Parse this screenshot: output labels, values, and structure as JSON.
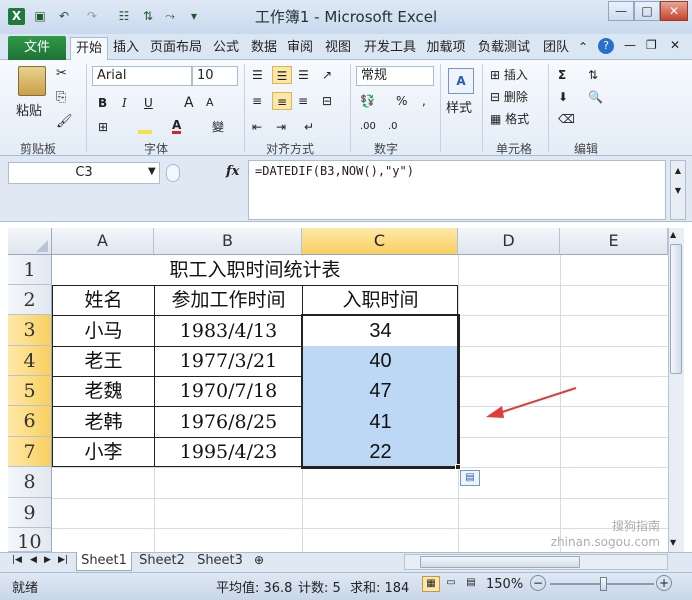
{
  "window": {
    "title": "工作簿1 - Microsoft Excel",
    "app_icon": "excel-icon",
    "controls": [
      "—",
      "□",
      "✕"
    ]
  },
  "tabs": {
    "file": "文件",
    "items": [
      "开始",
      "插入",
      "页面布局",
      "公式",
      "数据",
      "审阅",
      "视图",
      "开发工具",
      "加载项",
      "负载测试",
      "团队"
    ],
    "active": "开始"
  },
  "ribbon": {
    "clipboard": {
      "paste": "粘贴",
      "group": "剪贴板"
    },
    "font": {
      "name": "Arial",
      "size": "10",
      "bold": "B",
      "italic": "I",
      "underline": "U",
      "grow": "A",
      "shrink": "A",
      "group": "字体",
      "wen": "變"
    },
    "alignment": {
      "group": "对齐方式"
    },
    "number": {
      "format": "常规",
      "percent": "%",
      "comma": ",",
      "group": "数字"
    },
    "styles": {
      "label": "样式"
    },
    "cells": {
      "insert": "插入",
      "delete": "删除",
      "format": "格式",
      "group": "单元格"
    },
    "editing": {
      "sigma": "Σ",
      "group": "编辑"
    }
  },
  "formula_bar": {
    "name_box": "C3",
    "fx": "fx",
    "formula": "=DATEDIF(B3,NOW(),\"y\")"
  },
  "grid": {
    "columns": [
      "A",
      "B",
      "C",
      "D",
      "E"
    ],
    "rows": [
      "1",
      "2",
      "3",
      "4",
      "5",
      "6",
      "7",
      "8",
      "9",
      "10"
    ],
    "selected_column": "C",
    "selected_rows": [
      "3",
      "4",
      "5",
      "6",
      "7"
    ],
    "title": "职工入职时间统计表",
    "headers": [
      "姓名",
      "参加工作时间",
      "入职时间"
    ],
    "records": [
      {
        "name": "小马",
        "date": "1983/4/13",
        "years": "34"
      },
      {
        "name": "老王",
        "date": "1977/3/21",
        "years": "40"
      },
      {
        "name": "老魏",
        "date": "1970/7/18",
        "years": "47"
      },
      {
        "name": "老韩",
        "date": "1976/8/25",
        "years": "41"
      },
      {
        "name": "小李",
        "date": "1995/4/23",
        "years": "22"
      }
    ]
  },
  "sheet_tabs": [
    "Sheet1",
    "Sheet2",
    "Sheet3"
  ],
  "status_bar": {
    "mode": "就绪",
    "average": "平均值: 36.8",
    "count": "计数: 5",
    "sum": "求和: 184",
    "zoom": "150%"
  },
  "watermark": "搜狗指南 zhinan.sogou.com",
  "colors": {
    "file_tab": "#2f9a47",
    "selection": "#bcd8f4",
    "header_highlight": "#f8cf5f",
    "arrow": "#e33a3a"
  }
}
